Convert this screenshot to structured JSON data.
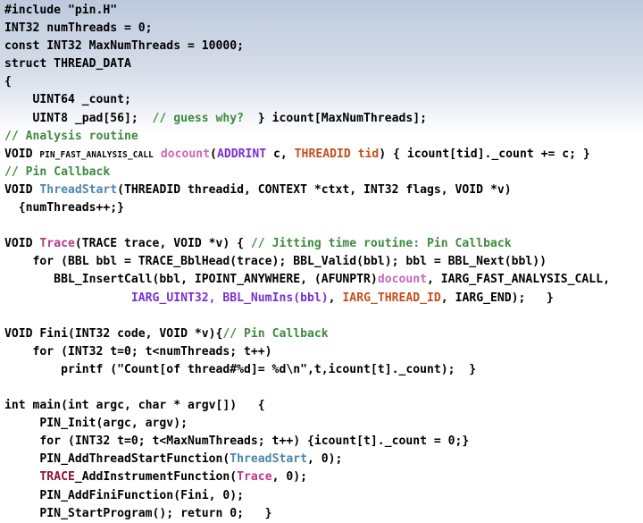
{
  "slide": {
    "title": "Pin Tool Source Code Slide",
    "background_top_color": "#bcc9dc",
    "background_bottom_color": "#ffffff"
  },
  "theme": {
    "text_color": "#000000",
    "comment_color": "#3d8b3d",
    "function_pink": "#c0338a",
    "function_magenta": "#cc66bb",
    "keyword_purple": "#7b2fd0",
    "keyword_orange": "#c4501e",
    "function_blue": "#4a87ad",
    "trace_dark_red": "#8b1538"
  },
  "code": {
    "language": "cpp",
    "lines": [
      {
        "id": "l1",
        "segments": [
          {
            "text": "#include \"pin.H\"",
            "style": "plain"
          }
        ]
      },
      {
        "id": "l2",
        "segments": [
          {
            "text": "INT32 numThreads = 0;",
            "style": "plain"
          }
        ]
      },
      {
        "id": "l3",
        "segments": [
          {
            "text": "const INT32 MaxNumThreads = 10000;",
            "style": "plain"
          }
        ]
      },
      {
        "id": "l4",
        "segments": [
          {
            "text": "struct THREAD_DATA",
            "style": "plain"
          }
        ]
      },
      {
        "id": "l5",
        "segments": [
          {
            "text": "{",
            "style": "plain"
          }
        ]
      },
      {
        "id": "l6",
        "segments": [
          {
            "text": "    UINT64 _count;",
            "style": "plain"
          }
        ]
      },
      {
        "id": "l7",
        "segments": [
          {
            "text": "    UINT8 _pad[56];  ",
            "style": "plain"
          },
          {
            "text": "// guess why?",
            "style": "comment"
          },
          {
            "text": "  } icount[MaxNumThreads];",
            "style": "plain"
          }
        ]
      },
      {
        "id": "l8",
        "segments": [
          {
            "text": "// Analysis routine",
            "style": "comment"
          }
        ]
      },
      {
        "id": "l9",
        "segments": [
          {
            "text": "VOID ",
            "style": "plain"
          },
          {
            "text": "PIN_FAST_ANALYSIS_CALL",
            "style": "small"
          },
          {
            "text": " ",
            "style": "plain"
          },
          {
            "text": "docount",
            "style": "function_magenta"
          },
          {
            "text": "(",
            "style": "plain"
          },
          {
            "text": "ADDRINT",
            "style": "keyword_purple"
          },
          {
            "text": " c, ",
            "style": "plain"
          },
          {
            "text": "THREADID tid",
            "style": "keyword_orange"
          },
          {
            "text": ") { icount[tid]._count += c; }",
            "style": "plain"
          }
        ]
      },
      {
        "id": "l10",
        "segments": [
          {
            "text": "// Pin Callback",
            "style": "comment"
          }
        ]
      },
      {
        "id": "l11",
        "segments": [
          {
            "text": "VOID ",
            "style": "plain"
          },
          {
            "text": "ThreadStart",
            "style": "function_blue"
          },
          {
            "text": "(THREADID threadid, CONTEXT *ctxt, INT32 flags, VOID *v)",
            "style": "plain"
          }
        ]
      },
      {
        "id": "l12",
        "segments": [
          {
            "text": "  {numThreads++;}",
            "style": "plain"
          }
        ]
      },
      {
        "id": "l13",
        "blank": true,
        "segments": []
      },
      {
        "id": "l14",
        "segments": [
          {
            "text": "VOID ",
            "style": "plain"
          },
          {
            "text": "Trace",
            "style": "function_pink"
          },
          {
            "text": "(TRACE trace, VOID *v) { ",
            "style": "plain"
          },
          {
            "text": "// Jitting time routine: Pin Callback",
            "style": "comment"
          }
        ]
      },
      {
        "id": "l15",
        "segments": [
          {
            "text": "    for (BBL bbl = TRACE_BblHead(trace); BBL_Valid(bbl); bbl = BBL_Next(bbl))",
            "style": "plain"
          }
        ]
      },
      {
        "id": "l16",
        "segments": [
          {
            "text": "       BBL_InsertCall(bbl, IPOINT_ANYWHERE, (AFUNPTR)",
            "style": "plain"
          },
          {
            "text": "docount",
            "style": "function_magenta"
          },
          {
            "text": ", IARG_FAST_ANALYSIS_CALL,",
            "style": "plain"
          }
        ]
      },
      {
        "id": "l17",
        "segments": [
          {
            "text": "                  ",
            "style": "plain"
          },
          {
            "text": "IARG_UINT32, BBL_NumIns(bbl)",
            "style": "keyword_purple"
          },
          {
            "text": ", ",
            "style": "plain"
          },
          {
            "text": "IARG_THREAD_ID",
            "style": "keyword_orange"
          },
          {
            "text": ", IARG_END);   }",
            "style": "plain"
          }
        ]
      },
      {
        "id": "l18",
        "blank": true,
        "segments": []
      },
      {
        "id": "l19",
        "segments": [
          {
            "text": "VOID Fini(INT32 code, VOID *v){",
            "style": "plain"
          },
          {
            "text": "// Pin Callback",
            "style": "comment"
          }
        ]
      },
      {
        "id": "l20",
        "segments": [
          {
            "text": "    for (INT32 t=0; t<numThreads; t++)",
            "style": "plain"
          }
        ]
      },
      {
        "id": "l21",
        "segments": [
          {
            "text": "        printf (\"Count[of thread#%d]= %d\\n\",t,icount[t]._count);  }",
            "style": "plain"
          }
        ]
      },
      {
        "id": "l22",
        "blank": true,
        "segments": []
      },
      {
        "id": "l23",
        "segments": [
          {
            "text": "int main(int argc, char * argv[])   {",
            "style": "plain"
          }
        ]
      },
      {
        "id": "l24",
        "segments": [
          {
            "text": "     PIN_Init(argc, argv);",
            "style": "plain"
          }
        ]
      },
      {
        "id": "l25",
        "segments": [
          {
            "text": "     for (INT32 t=0; t<MaxNumThreads; t++) {icount[t]._count = 0;}",
            "style": "plain"
          }
        ]
      },
      {
        "id": "l26",
        "segments": [
          {
            "text": "     PIN_AddThreadStartFunction(",
            "style": "plain"
          },
          {
            "text": "ThreadStart",
            "style": "function_blue"
          },
          {
            "text": ", 0);",
            "style": "plain"
          }
        ]
      },
      {
        "id": "l27",
        "segments": [
          {
            "text": "     ",
            "style": "plain"
          },
          {
            "text": "TRACE",
            "style": "trace_dark_red"
          },
          {
            "text": "_AddInstrumentFunction(",
            "style": "plain"
          },
          {
            "text": "Trace",
            "style": "function_pink"
          },
          {
            "text": ", 0);",
            "style": "plain"
          }
        ]
      },
      {
        "id": "l28",
        "segments": [
          {
            "text": "     PIN_AddFiniFunction(Fini, 0);",
            "style": "plain"
          }
        ]
      },
      {
        "id": "l29",
        "segments": [
          {
            "text": "     PIN_StartProgram(); return 0;   }",
            "style": "plain"
          }
        ]
      }
    ]
  }
}
